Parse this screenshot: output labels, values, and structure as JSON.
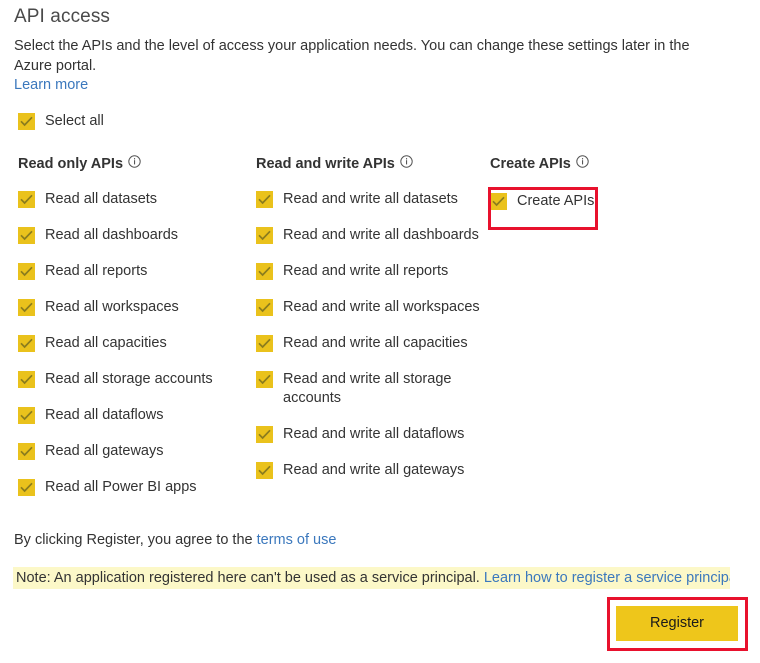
{
  "header": {
    "title": "API access",
    "description": "Select the APIs and the level of access your application needs. You can change these settings later in the Azure portal.",
    "learn_more_label": "Learn more"
  },
  "select_all": {
    "label": "Select all",
    "checked": true
  },
  "columns": {
    "read_only": {
      "heading": "Read only APIs",
      "info_icon": "info-circle-icon",
      "items": [
        {
          "label": "Read all datasets",
          "checked": true
        },
        {
          "label": "Read all dashboards",
          "checked": true
        },
        {
          "label": "Read all reports",
          "checked": true
        },
        {
          "label": "Read all workspaces",
          "checked": true
        },
        {
          "label": "Read all capacities",
          "checked": true
        },
        {
          "label": "Read all storage accounts",
          "checked": true
        },
        {
          "label": "Read all dataflows",
          "checked": true
        },
        {
          "label": "Read all gateways",
          "checked": true
        },
        {
          "label": "Read all Power BI apps",
          "checked": true
        }
      ]
    },
    "read_write": {
      "heading": "Read and write APIs",
      "info_icon": "info-circle-icon",
      "items": [
        {
          "label": "Read and write all datasets",
          "checked": true
        },
        {
          "label": "Read and write all dashboards",
          "checked": true
        },
        {
          "label": "Read and write all reports",
          "checked": true
        },
        {
          "label": "Read and write all workspaces",
          "checked": true
        },
        {
          "label": "Read and write all capacities",
          "checked": true
        },
        {
          "label": "Read and write all storage accounts",
          "checked": true
        },
        {
          "label": "Read and write all dataflows",
          "checked": true
        },
        {
          "label": "Read and write all gateways",
          "checked": true
        }
      ]
    },
    "create": {
      "heading": "Create APIs",
      "info_icon": "info-circle-icon",
      "items": [
        {
          "label": "Create APIs",
          "checked": true
        }
      ]
    }
  },
  "footer": {
    "terms_prefix": "By clicking Register, you agree to the ",
    "terms_link_label": "terms of use",
    "note_text": "Note: An application registered here can't be used as a service principal. ",
    "note_link_label": "Learn how to register a service principal",
    "register_label": "Register"
  },
  "colors": {
    "checkbox_yellow": "#eac21c",
    "button_yellow": "#eec61b",
    "highlight_red": "#e8112d",
    "link_blue": "#3b78bd",
    "note_background": "#fcf8c8"
  }
}
